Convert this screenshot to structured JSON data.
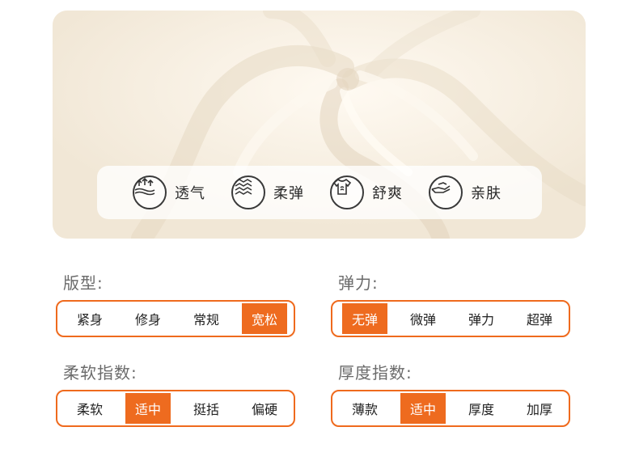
{
  "features": [
    {
      "icon": "breathable-icon",
      "label": "透气"
    },
    {
      "icon": "wave-stretch-icon",
      "label": "柔弹"
    },
    {
      "icon": "shirt-icon",
      "label": "舒爽"
    },
    {
      "icon": "hand-icon",
      "label": "亲肤"
    }
  ],
  "groups": [
    {
      "title": "版型:",
      "options": [
        "紧身",
        "修身",
        "常规",
        "宽松"
      ],
      "selected": "宽松"
    },
    {
      "title": "弹力:",
      "options": [
        "无弹",
        "微弹",
        "弹力",
        "超弹"
      ],
      "selected": "无弹"
    },
    {
      "title": "柔软指数:",
      "options": [
        "柔软",
        "适中",
        "挺括",
        "偏硬"
      ],
      "selected": "适中"
    },
    {
      "title": "厚度指数:",
      "options": [
        "薄款",
        "适中",
        "厚度",
        "加厚"
      ],
      "selected": "适中"
    }
  ],
  "colors": {
    "accent": "#ee6b1f",
    "fabric": "#f6efe3"
  }
}
